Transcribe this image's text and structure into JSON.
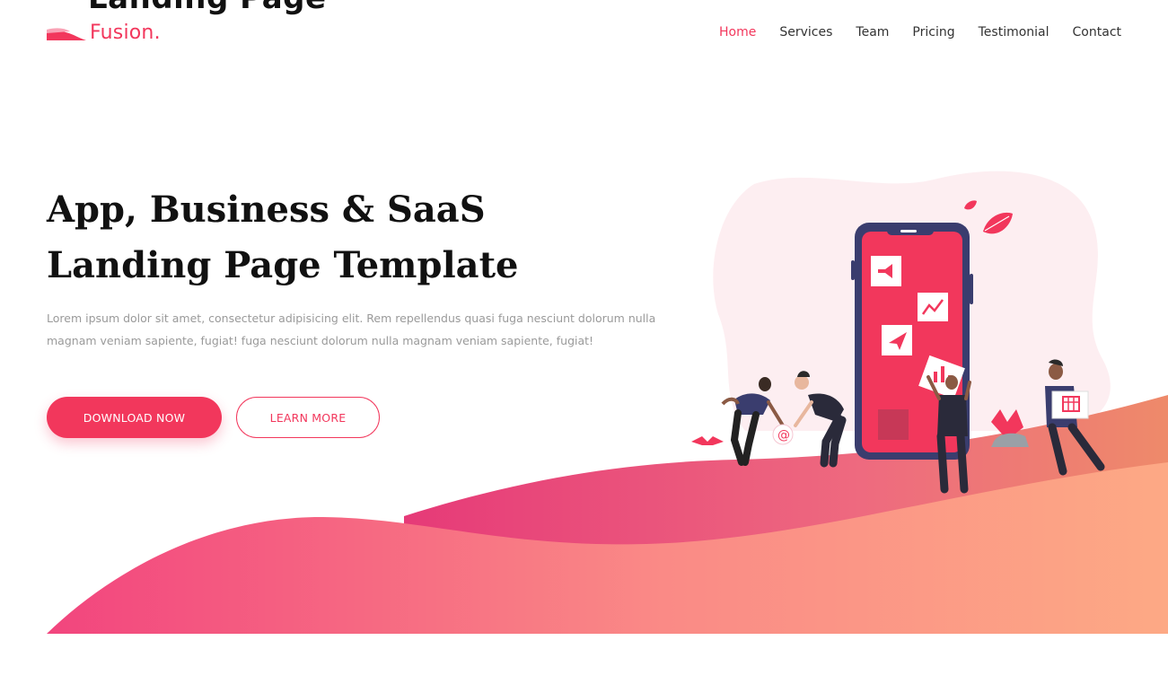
{
  "page_title_fragment": "Landing Page",
  "brand": {
    "name": "Fusion.",
    "accent_color": "#f2375c"
  },
  "nav": {
    "items": [
      {
        "label": "Home",
        "active": true
      },
      {
        "label": "Services",
        "active": false
      },
      {
        "label": "Team",
        "active": false
      },
      {
        "label": "Pricing",
        "active": false
      },
      {
        "label": "Testimonial",
        "active": false
      },
      {
        "label": "Contact",
        "active": false
      }
    ]
  },
  "hero": {
    "title_line1": "App, Business & SaaS",
    "title_line2": "Landing Page Template",
    "text": "Lorem ipsum dolor sit amet, consectetur adipisicing elit. Rem repellendus quasi fuga nesciunt dolorum nulla magnam veniam sapiente, fugiat! fuga nesciunt dolorum nulla magnam veniam sapiente, fugiat!",
    "primary_button": "DOWNLOAD NOW",
    "secondary_button": "LEARN MORE"
  },
  "illustration": {
    "icons": [
      "megaphone-icon",
      "chart-icon",
      "paper-plane-icon",
      "at-sign-icon",
      "calendar-icon",
      "leaf-icon"
    ]
  },
  "colors": {
    "gradient_pink": "#f2457e",
    "gradient_orange": "#fda985",
    "blob": "#fdeef1",
    "phone_frame": "#3a3d6e"
  }
}
